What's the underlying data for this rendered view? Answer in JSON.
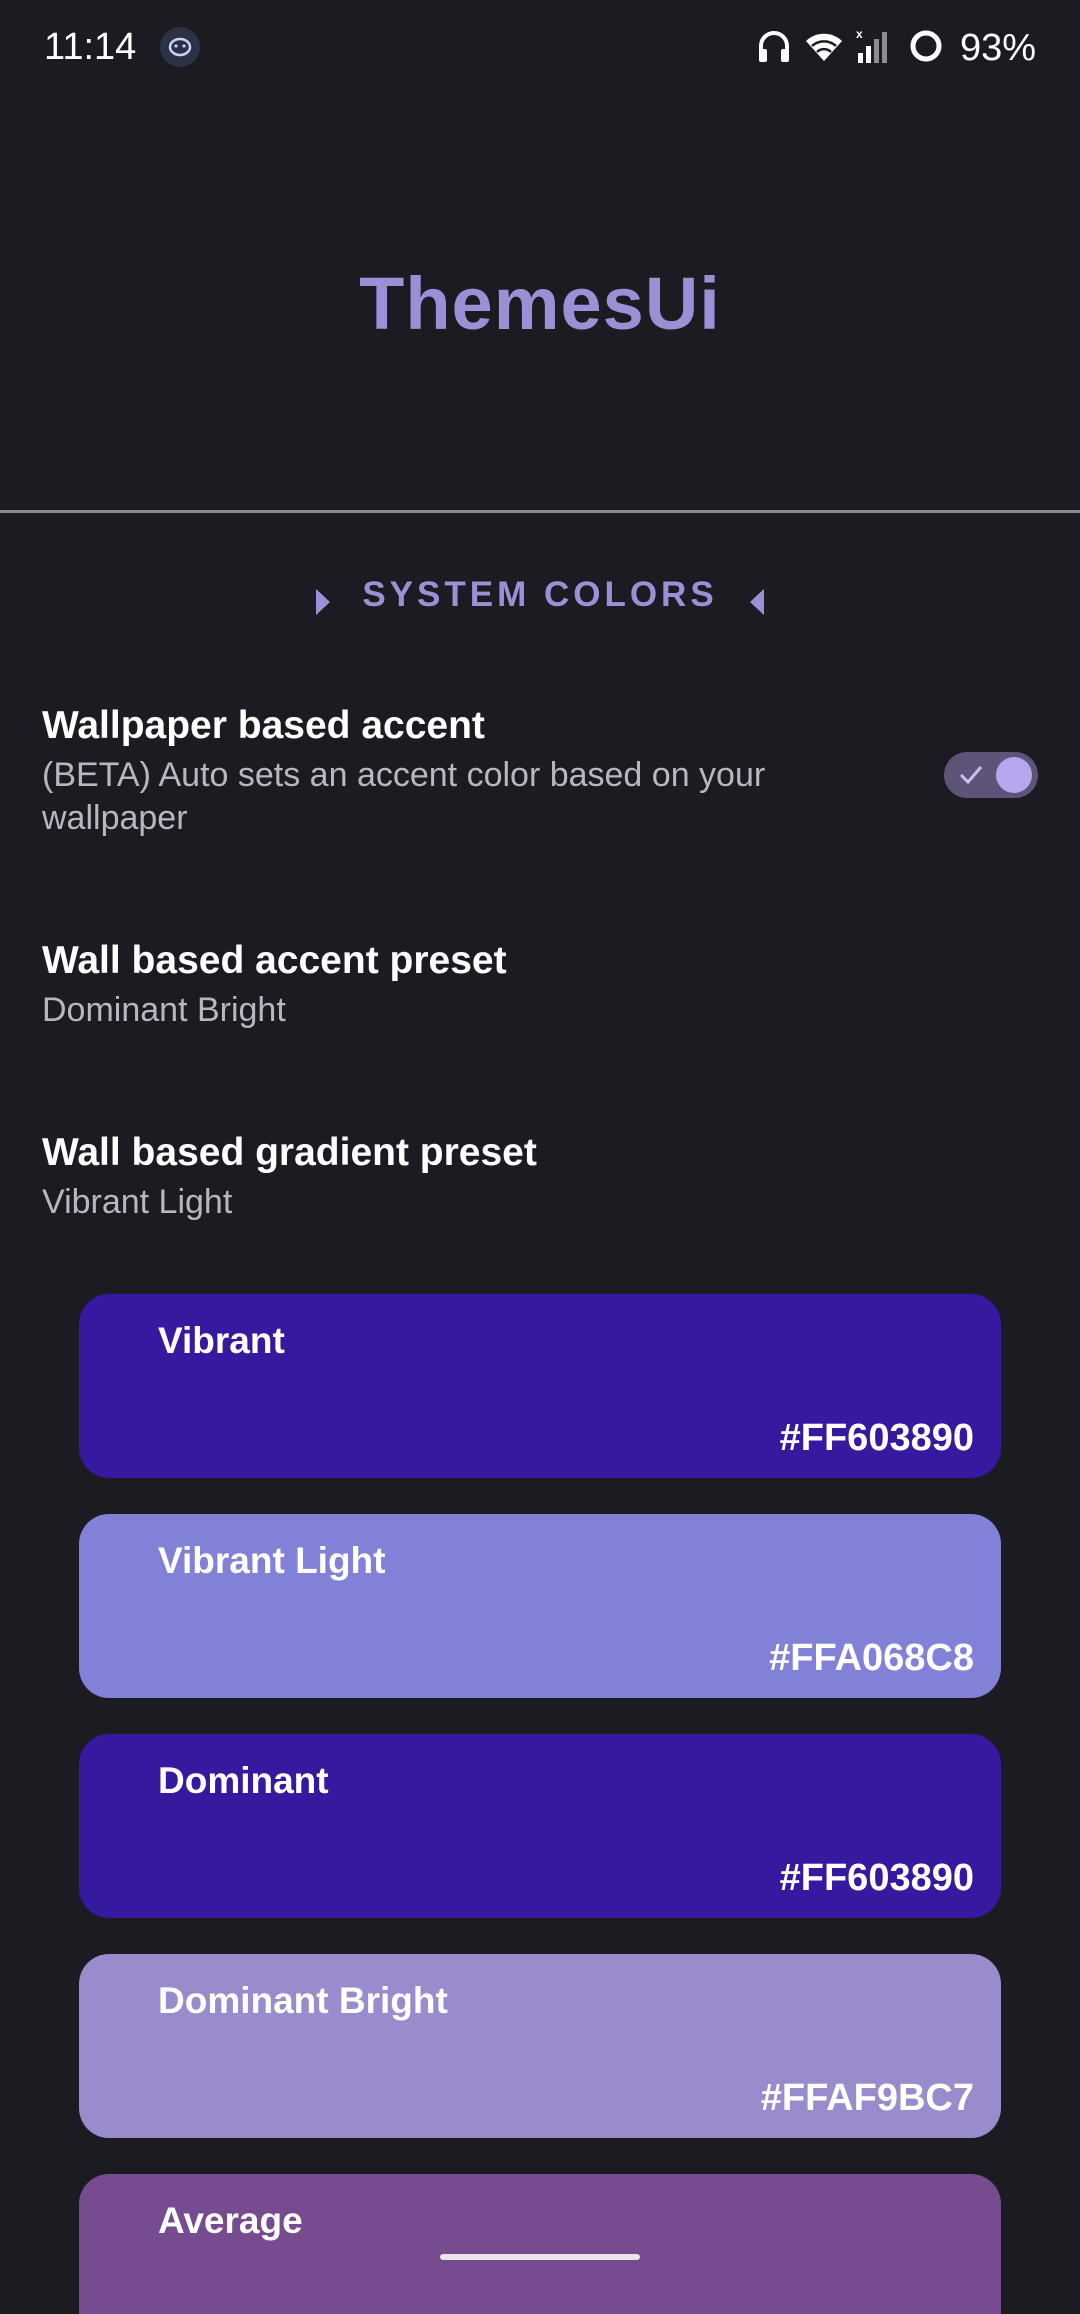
{
  "status_bar": {
    "time": "11:14",
    "battery": "93%"
  },
  "header": {
    "title": "ThemesUi"
  },
  "section": {
    "title": "SYSTEM COLORS"
  },
  "prefs": {
    "wallpaper_accent": {
      "title": "Wallpaper based accent",
      "summary": "(BETA) Auto sets an accent color based on your wallpaper",
      "enabled": true
    },
    "accent_preset": {
      "title": "Wall based accent preset",
      "summary": "Dominant Bright"
    },
    "gradient_preset": {
      "title": "Wall based gradient preset",
      "summary": "Vibrant Light"
    }
  },
  "colors": [
    {
      "name": "Vibrant",
      "hex": "#FF603890",
      "bg": "#36199f"
    },
    {
      "name": "Vibrant Light",
      "hex": "#FFA068C8",
      "bg": "#8181d7"
    },
    {
      "name": "Dominant",
      "hex": "#FF603890",
      "bg": "#36199f"
    },
    {
      "name": "Dominant Bright",
      "hex": "#FFAF9BC7",
      "bg": "#998bcc"
    },
    {
      "name": "Average",
      "hex": "",
      "bg": "#764b8f"
    }
  ],
  "accent_color": "#9d8fd6"
}
